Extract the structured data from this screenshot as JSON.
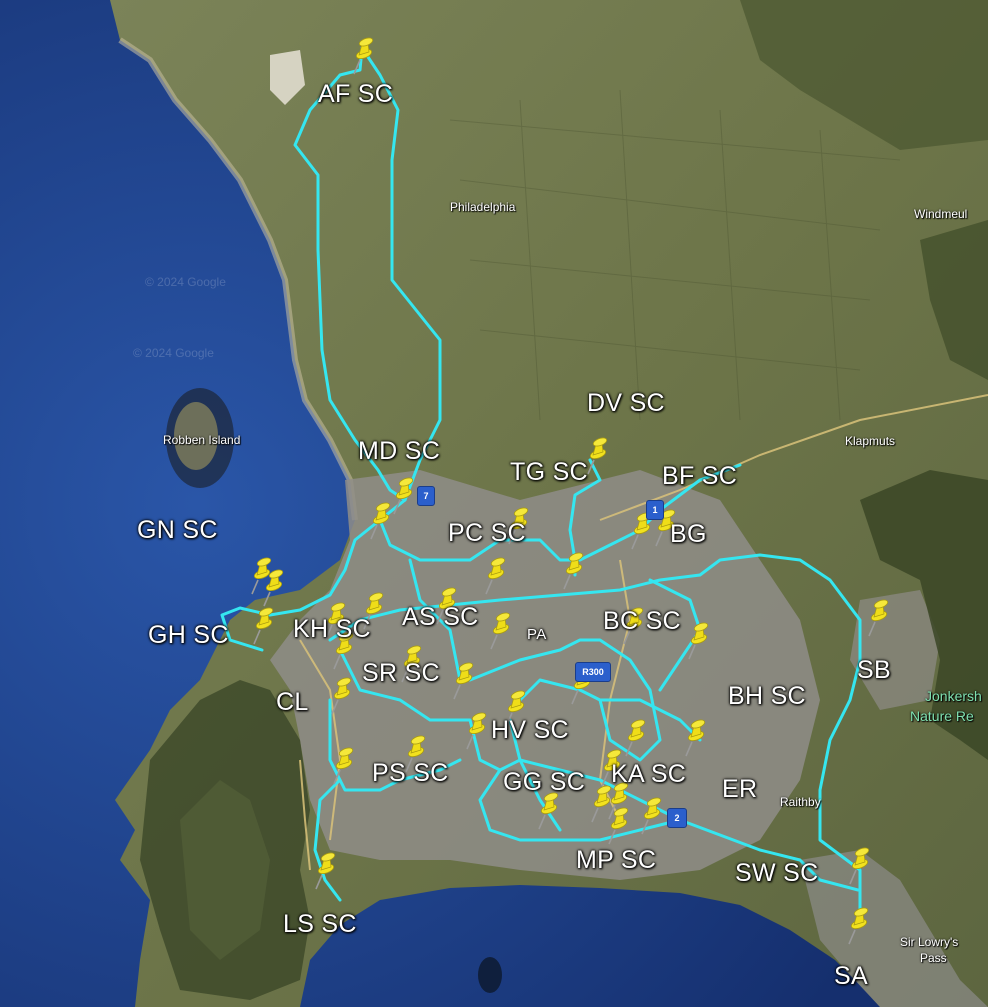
{
  "map": {
    "attribution": "© 2024 Google"
  },
  "labels": {
    "AF": "AF SC",
    "DV": "DV SC",
    "MD": "MD SC",
    "TG": "TG SC",
    "BF": "BF SC",
    "GN": "GN SC",
    "PC": "PC SC",
    "BG": "BG",
    "GH": "GH SC",
    "KH": "KH SC",
    "AS": "AS SC",
    "BC": "BC SC",
    "SB": "SB",
    "SR": "SR SC",
    "CL": "CL",
    "BH": "BH SC",
    "HV": "HV SC",
    "PS": "PS SC",
    "GG": "GG SC",
    "KA": "KA SC",
    "ER": "ER",
    "MP": "MP SC",
    "SW": "SW SC",
    "LS": "LS SC",
    "SA": "SA",
    "PA": "PA"
  },
  "places": {
    "philadelphia": "Philadelphia",
    "windmeul": "Windmeul",
    "robben_island": "Robben Island",
    "klapmuts": "Klapmuts",
    "raithby": "Raithby",
    "sir_lowrys_1": "Sir Lowry's",
    "sir_lowrys_2": "Pass",
    "jonkers_1": "Jonkersh",
    "jonkers_2": "Nature Re"
  },
  "route_shields": {
    "r7": "7",
    "r1": "1",
    "r300": "R300",
    "r2": "2"
  },
  "colors": {
    "ocean": "#1e3f86",
    "land": "#6f7a4e",
    "urban": "#8d8b86",
    "route": "#35e6f0",
    "pin": "#f2e21e",
    "shield": "#2b5fcc"
  },
  "marker_icon": "yellow-pushpin-icon"
}
